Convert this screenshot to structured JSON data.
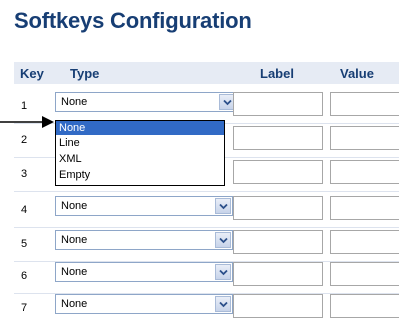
{
  "page": {
    "title": "Softkeys Configuration"
  },
  "table": {
    "headers": {
      "key": "Key",
      "type": "Type",
      "label": "Label",
      "value": "Value"
    },
    "rows": [
      {
        "key": "1",
        "type": "None"
      },
      {
        "key": "2",
        "type": ""
      },
      {
        "key": "3",
        "type": ""
      },
      {
        "key": "4",
        "type": "None"
      },
      {
        "key": "5",
        "type": "None"
      },
      {
        "key": "6",
        "type": "None"
      },
      {
        "key": "7",
        "type": "None"
      }
    ]
  },
  "dropdown": {
    "options": [
      "None",
      "Line",
      "XML",
      "Empty"
    ],
    "selected": "None"
  },
  "icons": {
    "select_button": "chevron-down-icon",
    "pointer": "arrow-right-icon"
  },
  "colors": {
    "title": "#173e74",
    "header_bg": "#e6ebf4",
    "selection": "#316ac5"
  }
}
